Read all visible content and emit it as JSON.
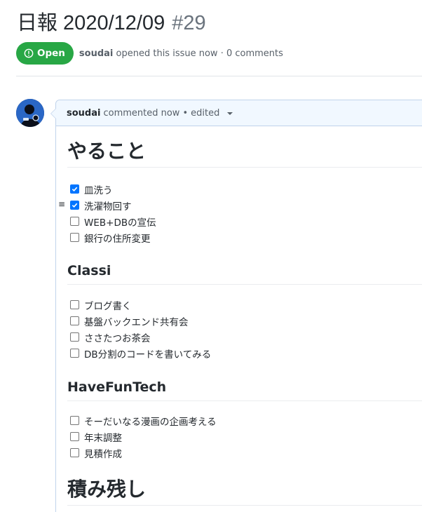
{
  "issue": {
    "title": "日報 2020/12/09",
    "number": "#29",
    "state": "Open",
    "author": "soudai",
    "meta_suffix": "opened this issue now · 0 comments"
  },
  "comment": {
    "author": "soudai",
    "action": "commented now",
    "separator": "•",
    "edited": "edited"
  },
  "sections": [
    {
      "heading": "やること",
      "level": 1,
      "tasks": [
        {
          "label": "皿洗う",
          "checked": true
        },
        {
          "label": "洗濯物回す",
          "checked": true
        },
        {
          "label": "WEB+DBの宣伝",
          "checked": false
        },
        {
          "label": "銀行の住所変更",
          "checked": false
        }
      ]
    },
    {
      "heading": "Classi",
      "level": 2,
      "tasks": [
        {
          "label": "ブログ書く",
          "checked": false
        },
        {
          "label": "基盤バックエンド共有会",
          "checked": false
        },
        {
          "label": "ささたつお茶会",
          "checked": false
        },
        {
          "label": "DB分割のコードを書いてみる",
          "checked": false
        }
      ]
    },
    {
      "heading": "HaveFunTech",
      "level": 2,
      "tasks": [
        {
          "label": "そーだいなる漫画の企画考える",
          "checked": false
        },
        {
          "label": "年末調整",
          "checked": false
        },
        {
          "label": "見積作成",
          "checked": false
        }
      ]
    },
    {
      "heading": "積み残し",
      "level": 1,
      "tasks": []
    }
  ],
  "colors": {
    "open_badge": "#28a745",
    "checkbox_checked": "#0075ff",
    "comment_header_bg": "#f1f8ff"
  }
}
